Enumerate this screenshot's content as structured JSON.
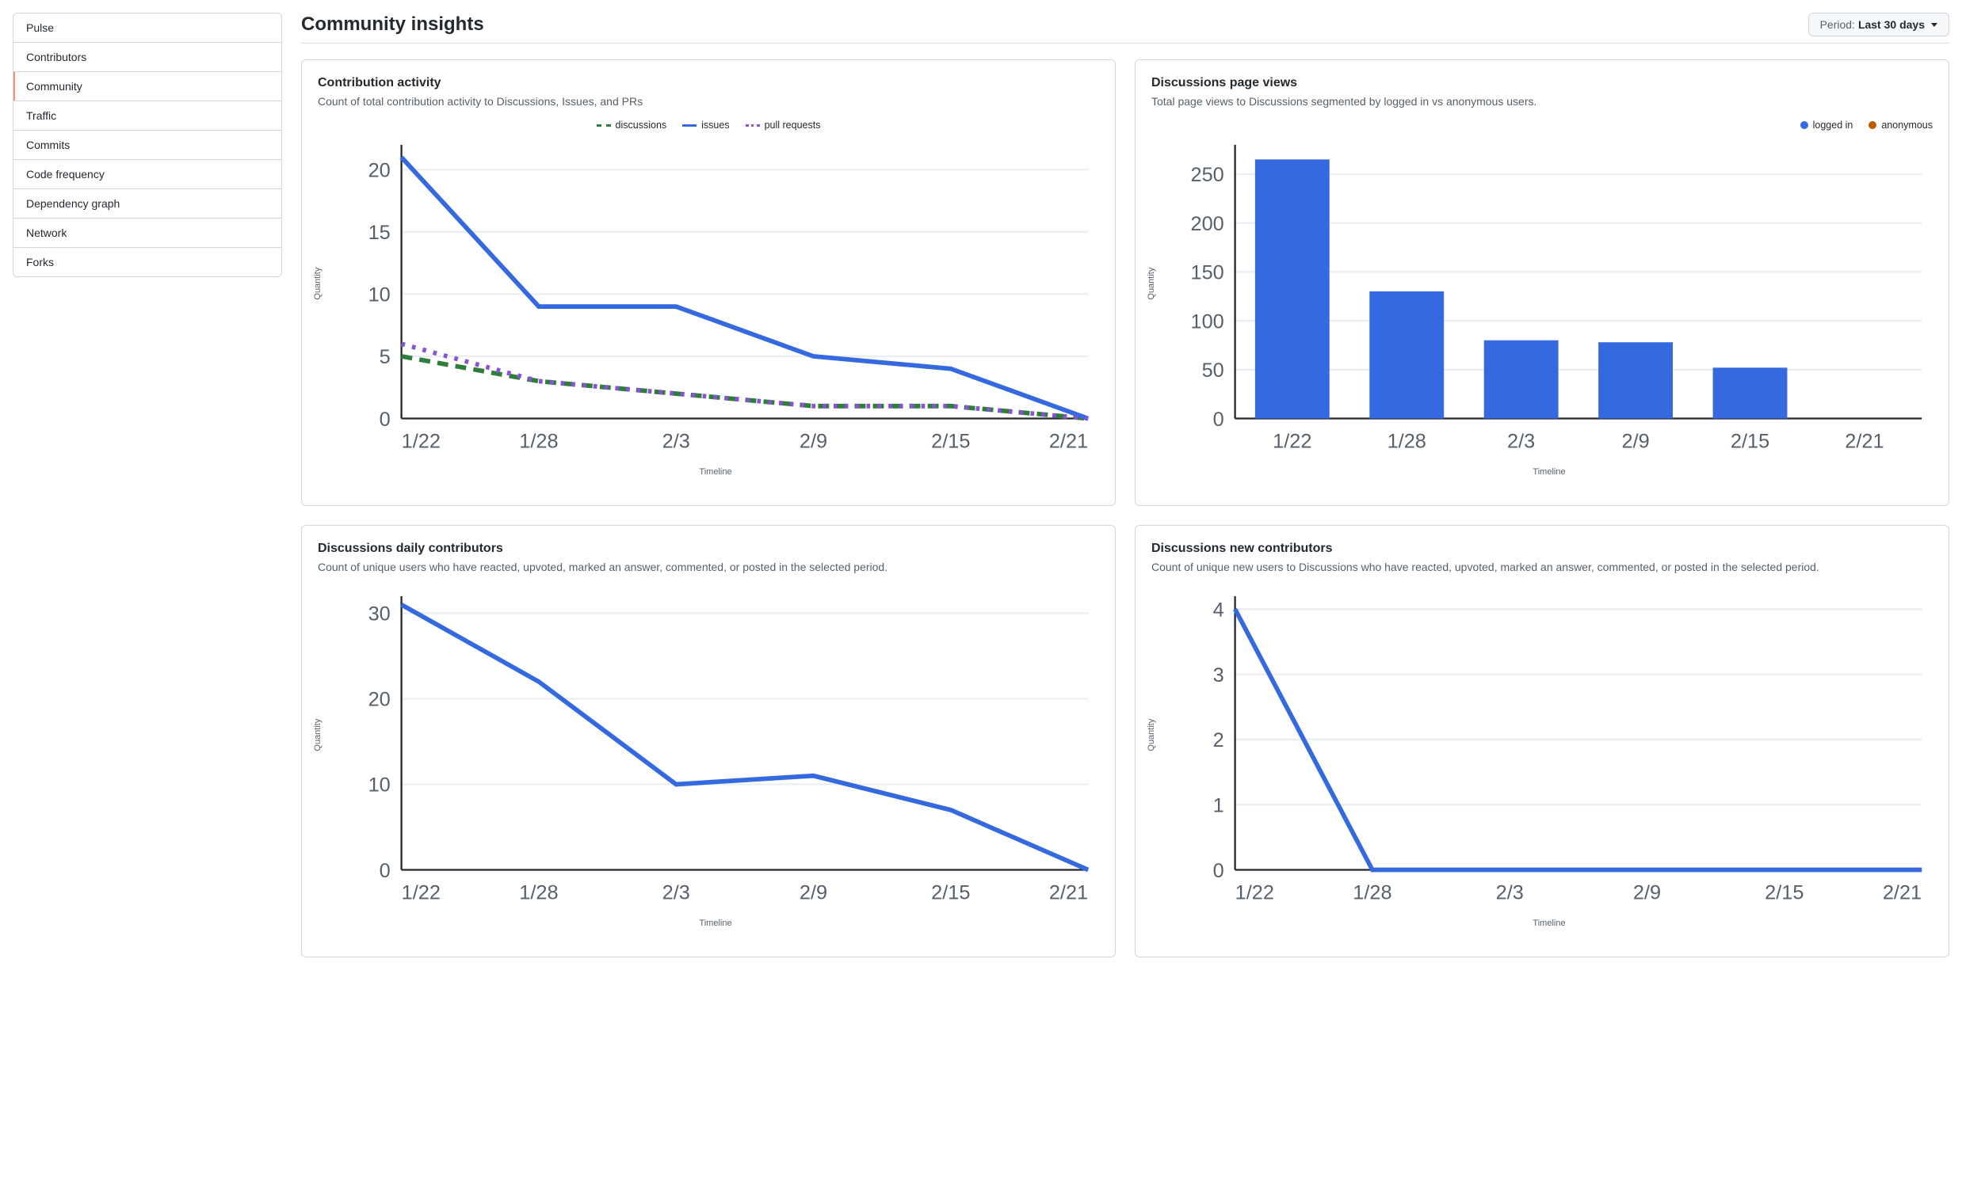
{
  "sidebar": {
    "items": [
      {
        "label": "Pulse"
      },
      {
        "label": "Contributors"
      },
      {
        "label": "Community"
      },
      {
        "label": "Traffic"
      },
      {
        "label": "Commits"
      },
      {
        "label": "Code frequency"
      },
      {
        "label": "Dependency graph"
      },
      {
        "label": "Network"
      },
      {
        "label": "Forks"
      }
    ],
    "active_index": 2
  },
  "header": {
    "title": "Community insights",
    "period_label": "Period:",
    "period_value": "Last 30 days"
  },
  "cards": {
    "contribution": {
      "title": "Contribution activity",
      "desc": "Count of total contribution activity to Discussions, Issues, and PRs",
      "ylabel": "Quantity",
      "xlabel": "Timeline"
    },
    "pageviews": {
      "title": "Discussions page views",
      "desc": "Total page views to Discussions segmented by logged in vs anonymous users.",
      "ylabel": "Quantity",
      "xlabel": "Timeline"
    },
    "daily": {
      "title": "Discussions daily contributors",
      "desc": "Count of unique users who have reacted, upvoted, marked an answer, commented, or posted in the selected period.",
      "ylabel": "Quantity",
      "xlabel": "Timeline"
    },
    "new": {
      "title": "Discussions new contributors",
      "desc": "Count of unique new users to Discussions who have reacted, upvoted, marked an answer, commented, or posted in the selected period.",
      "ylabel": "Quantity",
      "xlabel": "Timeline"
    }
  },
  "colors": {
    "issues": "#3569e0",
    "discussions": "#2f7d3b",
    "pull_requests": "#8753d4",
    "logged_in": "#3569e0",
    "anonymous": "#bd5b00",
    "line_primary": "#3569e0"
  },
  "chart_data": [
    {
      "id": "contribution",
      "type": "line",
      "title": "Contribution activity",
      "xlabel": "Timeline",
      "ylabel": "Quantity",
      "categories": [
        "1/22",
        "1/28",
        "2/3",
        "2/9",
        "2/15",
        "2/21"
      ],
      "yticks": [
        0,
        5,
        10,
        15,
        20
      ],
      "ylim": [
        0,
        22
      ],
      "series": [
        {
          "name": "discussions",
          "style": "dashed",
          "color": "#2f7d3b",
          "values": [
            5,
            3,
            2,
            1,
            1,
            0
          ]
        },
        {
          "name": "issues",
          "style": "solid",
          "color": "#3569e0",
          "values": [
            21,
            9,
            9,
            5,
            4,
            0
          ]
        },
        {
          "name": "pull requests",
          "style": "dotted",
          "color": "#8753d4",
          "values": [
            6,
            3,
            2,
            1,
            1,
            0
          ]
        }
      ]
    },
    {
      "id": "pageviews",
      "type": "bar",
      "title": "Discussions page views",
      "xlabel": "Timeline",
      "ylabel": "Quantity",
      "categories": [
        "1/22",
        "1/28",
        "2/3",
        "2/9",
        "2/15",
        "2/21"
      ],
      "yticks": [
        0,
        50,
        100,
        150,
        200,
        250
      ],
      "ylim": [
        0,
        280
      ],
      "series": [
        {
          "name": "logged in",
          "color": "#3569e0",
          "values": [
            265,
            130,
            80,
            78,
            52,
            0
          ]
        },
        {
          "name": "anonymous",
          "color": "#bd5b00",
          "values": [
            0,
            0,
            0,
            0,
            0,
            0
          ]
        }
      ]
    },
    {
      "id": "daily",
      "type": "line",
      "title": "Discussions daily contributors",
      "xlabel": "Timeline",
      "ylabel": "Quantity",
      "categories": [
        "1/22",
        "1/28",
        "2/3",
        "2/9",
        "2/15",
        "2/21"
      ],
      "yticks": [
        0,
        10,
        20,
        30
      ],
      "ylim": [
        0,
        32
      ],
      "series": [
        {
          "name": "contributors",
          "style": "solid",
          "color": "#3569e0",
          "values": [
            31,
            22,
            10,
            11,
            7,
            0
          ]
        }
      ]
    },
    {
      "id": "new",
      "type": "line",
      "title": "Discussions new contributors",
      "xlabel": "Timeline",
      "ylabel": "Quantity",
      "categories": [
        "1/22",
        "1/28",
        "2/3",
        "2/9",
        "2/15",
        "2/21"
      ],
      "yticks": [
        0,
        1,
        2,
        3,
        4
      ],
      "ylim": [
        0,
        4.2
      ],
      "series": [
        {
          "name": "new contributors",
          "style": "solid",
          "color": "#3569e0",
          "values": [
            4,
            0,
            0,
            0,
            0,
            0
          ]
        }
      ]
    }
  ]
}
